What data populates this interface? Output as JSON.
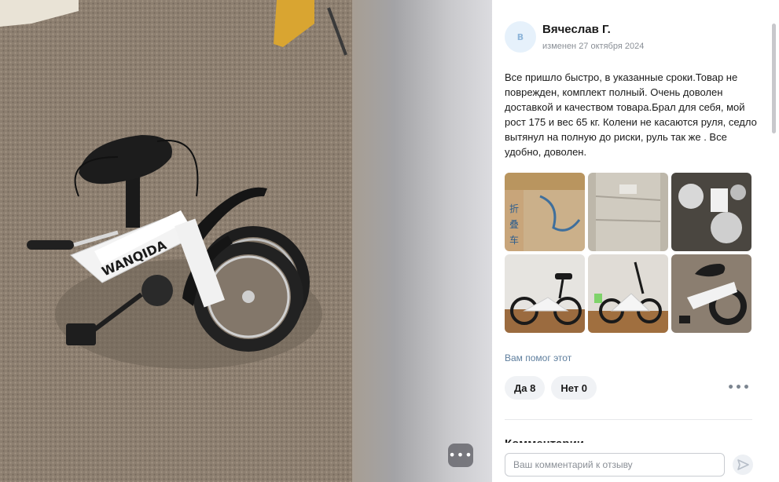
{
  "viewer": {
    "more_button_icon": "ellipsis-icon",
    "more_button_label": "•••"
  },
  "review": {
    "avatar_letter": "В",
    "author_name": "Вячеслав Г.",
    "date_text": "изменен 27 октября 2024",
    "text": "Все пришло быстро, в указанные сроки.Товар не поврежден, комплект полный. Очень доволен доставкой и качеством товара.Брал для себя, мой рост 175 и вес 65 кг. Колени не касаются руля, седло вытянул на полную до риски, руль так же . Все удобно, доволен.",
    "photos": [
      {
        "name": "photo-box-packaging"
      },
      {
        "name": "photo-wrapped-parts"
      },
      {
        "name": "photo-unpacked-parts"
      },
      {
        "name": "photo-bike-room"
      },
      {
        "name": "photo-bike-folding"
      },
      {
        "name": "photo-bike-folded"
      }
    ],
    "helpful_label": "Вам помог этот",
    "yes_label": "Да 8",
    "no_label": "Нет 0",
    "more_icon": "•••"
  },
  "comments": {
    "heading": "Комментарии",
    "placeholder": "Ваш комментарий к отзыву",
    "send_icon": "send-icon"
  },
  "colors": {
    "accent_link": "#5f7f9e",
    "vote_bg": "#f0f2f5",
    "text_primary": "#1a1a1a",
    "text_secondary": "#8a8f96"
  }
}
